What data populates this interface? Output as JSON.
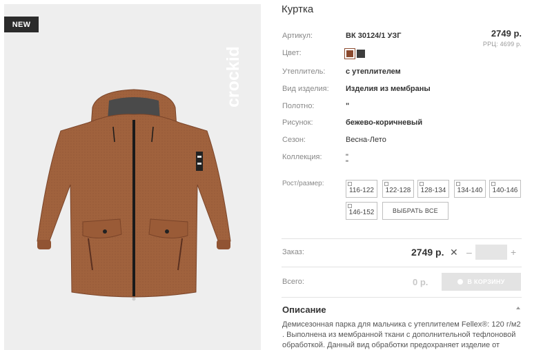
{
  "photo": {
    "badge": "NEW",
    "brand": "crockid"
  },
  "product": {
    "title": "Куртка",
    "price": "2749 р.",
    "rrp": "РРЦ: 4699 р.",
    "attributes": [
      {
        "label": "Артикул:",
        "value": "ВК 30124/1 УЗГ"
      },
      {
        "label": "Цвет:",
        "value": ""
      },
      {
        "label": "Утеплитель:",
        "value": "с утеплителем"
      },
      {
        "label": "Вид изделия:",
        "value": "Изделия из мембраны"
      },
      {
        "label": "Полотно:",
        "value": "\""
      },
      {
        "label": "Рисунок:",
        "value": "бежево-коричневый"
      },
      {
        "label": "Сезон:",
        "value": "Весна-Лето"
      },
      {
        "label": "Коллекция:",
        "value": "\""
      }
    ],
    "collection_extra": "\"",
    "colors": [
      "#8b4a2f",
      "#3d3d3d"
    ]
  },
  "sizes": {
    "label": "Рост/размер:",
    "options": [
      "116-122",
      "122-128",
      "128-134",
      "134-140",
      "140-146",
      "146-152"
    ],
    "select_all": "ВЫБРАТЬ ВСЕ"
  },
  "order": {
    "label": "Заказ:",
    "price": "2749 р.",
    "remove": "✕",
    "minus": "–",
    "plus": "+",
    "quantity": ""
  },
  "total": {
    "label": "Всего:",
    "value": "0 р.",
    "cart_button": "В КОРЗИНУ"
  },
  "description": {
    "title": "Описание",
    "text": "Демисезонная парка для мальчика с утеплителем Fellex®: 120 г/м2 . Выполнена из мембранной ткани с дополнительной тефлоновой обработкой. Данный вид обработки предохраняет изделие от"
  }
}
